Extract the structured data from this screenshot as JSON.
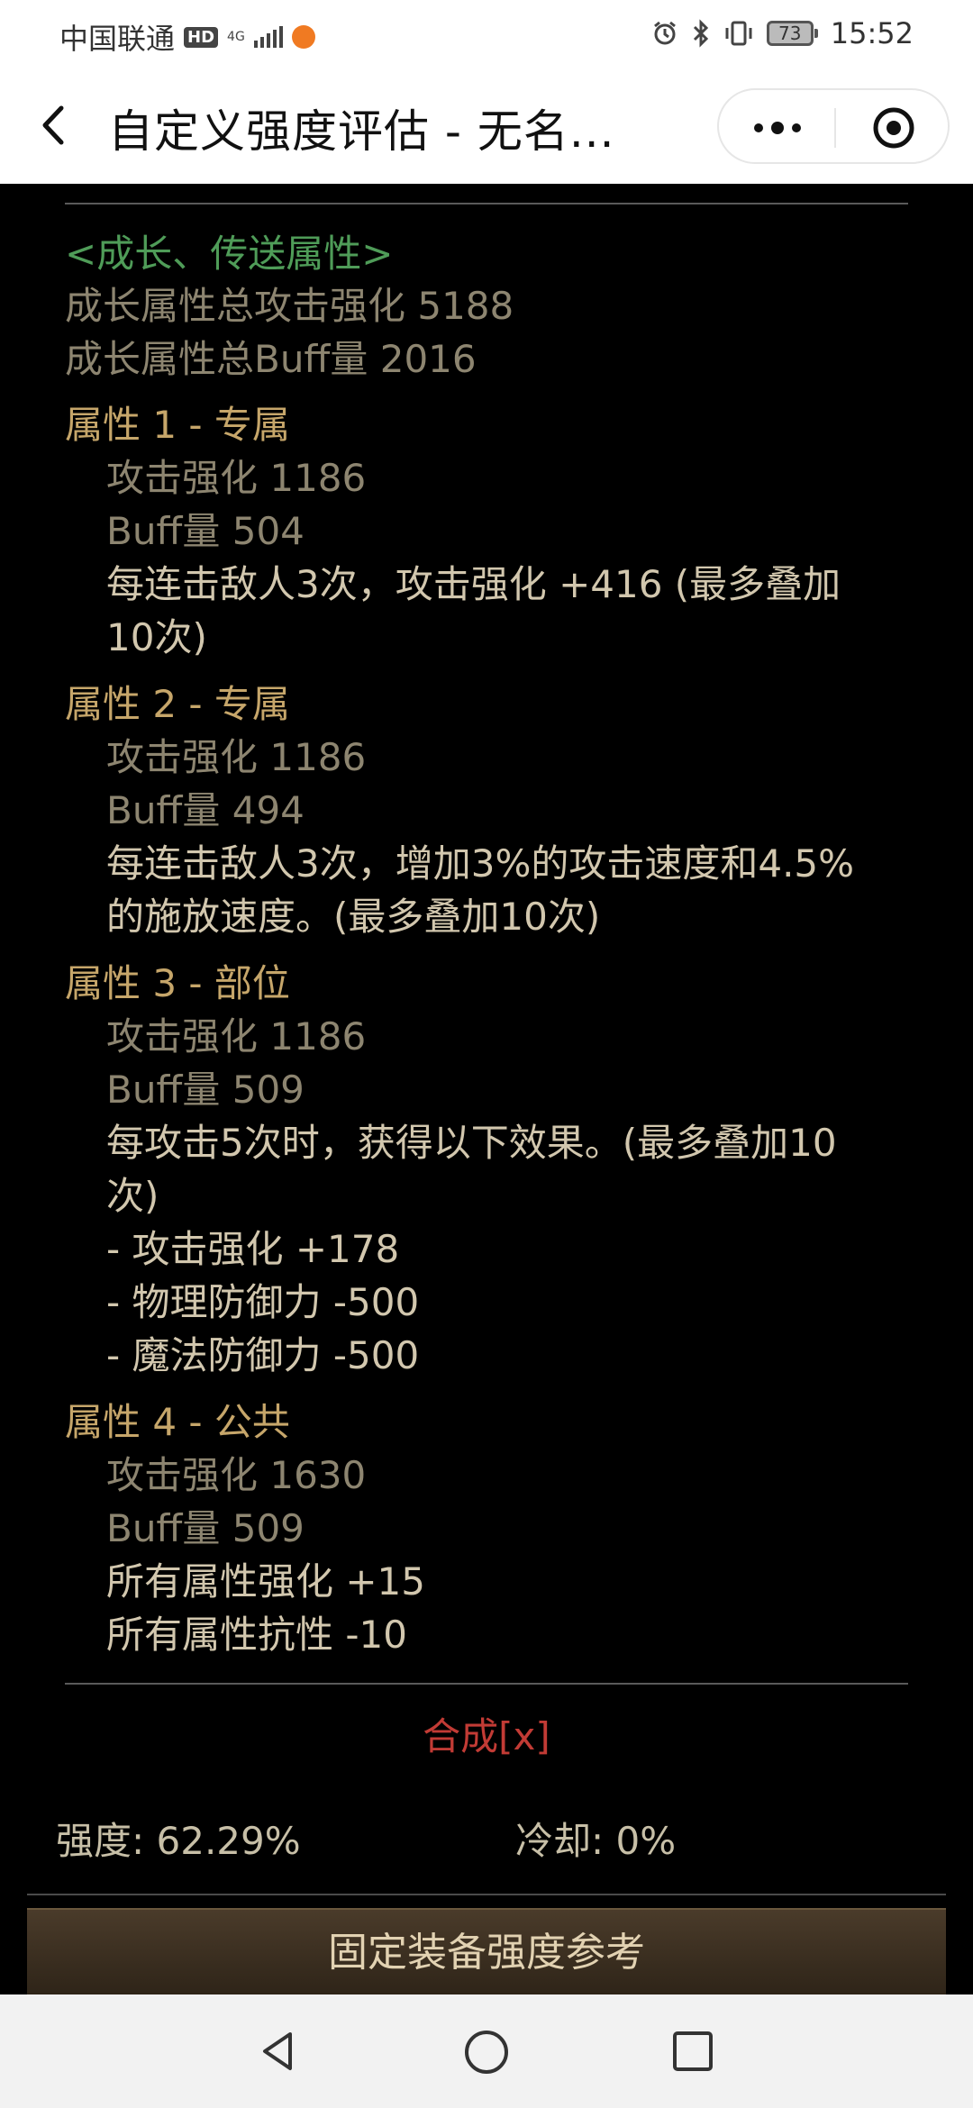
{
  "status_bar": {
    "carrier": "中国联通",
    "hd": "HD",
    "network": "4G",
    "battery": "73",
    "time": "15:52"
  },
  "header": {
    "title": "自定义强度评估 - 无名..."
  },
  "content": {
    "growth_header": "<成长、传送属性>",
    "growth_attack_total": "成长属性总攻击强化 5188",
    "growth_buff_total": "成长属性总Buff量 2016",
    "attributes": [
      {
        "title": "属性 1 - 专属",
        "attack": "攻击强化  1186",
        "buff": "Buff量  504",
        "effects": [
          "每连击敌人3次，攻击强化 +416 (最多叠加",
          "10次)"
        ]
      },
      {
        "title": "属性 2 - 专属",
        "attack": "攻击强化  1186",
        "buff": "Buff量  494",
        "effects": [
          "每连击敌人3次，增加3%的攻击速度和4.5%",
          "的施放速度。(最多叠加10次)"
        ]
      },
      {
        "title": "属性 3 - 部位",
        "attack": "攻击强化  1186",
        "buff": "Buff量  509",
        "effects": [
          "每攻击5次时，获得以下效果。(最多叠加10",
          "次)",
          "- 攻击强化 +178",
          "- 物理防御力 -500",
          "- 魔法防御力 -500"
        ]
      },
      {
        "title": "属性 4 - 公共",
        "attack": "攻击强化  1630",
        "buff": "Buff量  509",
        "effects": [
          "所有属性强化 +15",
          "所有属性抗性 -10"
        ]
      }
    ],
    "synth_link": "合成[x]",
    "strength": "强度: 62.29%",
    "cooldown": "冷却: 0%",
    "reference_button": "固定装备强度参考"
  }
}
